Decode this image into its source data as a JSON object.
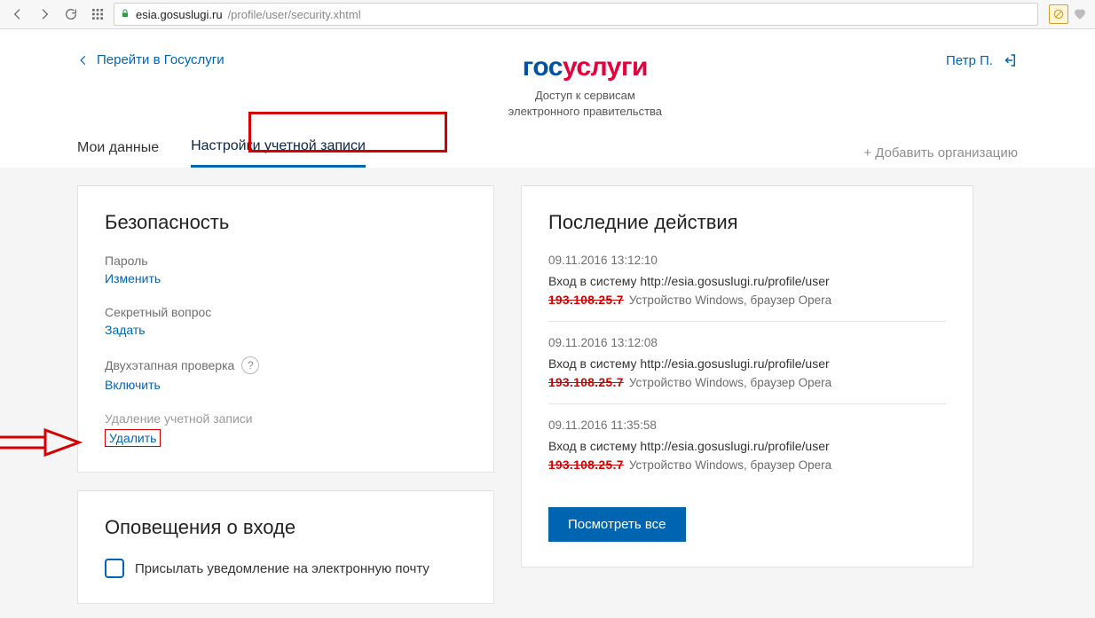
{
  "browser": {
    "url_host": "esia.gosuslugi.ru",
    "url_path": "/profile/user/security.xhtml"
  },
  "header": {
    "back_label": "Перейти в Госуслуги",
    "brand_part1": "гос",
    "brand_part2": "услуги",
    "brand_sub1": "Доступ к сервисам",
    "brand_sub2": "электронного правительства",
    "user_name": "Петр П."
  },
  "tabs": {
    "data": "Мои данные",
    "settings": "Настройки учетной записи",
    "add_org": "+ Добавить организацию"
  },
  "security": {
    "title": "Безопасность",
    "password_label": "Пароль",
    "password_action": "Изменить",
    "secret_label": "Секретный вопрос",
    "secret_action": "Задать",
    "twofa_label": "Двухэтапная проверка",
    "twofa_action": "Включить",
    "delete_label": "Удаление учетной записи",
    "delete_action": "Удалить"
  },
  "notify": {
    "title": "Оповещения о входе",
    "checkbox_label": "Присылать уведомление на электронную почту"
  },
  "actions": {
    "title": "Последние действия",
    "items": [
      {
        "time": "09.11.2016 13:12:10",
        "desc": "Вход в систему http://esia.gosuslugi.ru/profile/user",
        "ip": "193.108.25.7",
        "meta": "Устройство Windows, браузер Opera"
      },
      {
        "time": "09.11.2016 13:12:08",
        "desc": "Вход в систему http://esia.gosuslugi.ru/profile/user",
        "ip": "193.108.25.7",
        "meta": "Устройство Windows, браузер Opera"
      },
      {
        "time": "09.11.2016 11:35:58",
        "desc": "Вход в систему http://esia.gosuslugi.ru/profile/user",
        "ip": "193.108.25.7",
        "meta": "Устройство Windows, браузер Opera"
      }
    ],
    "view_all": "Посмотреть все"
  }
}
